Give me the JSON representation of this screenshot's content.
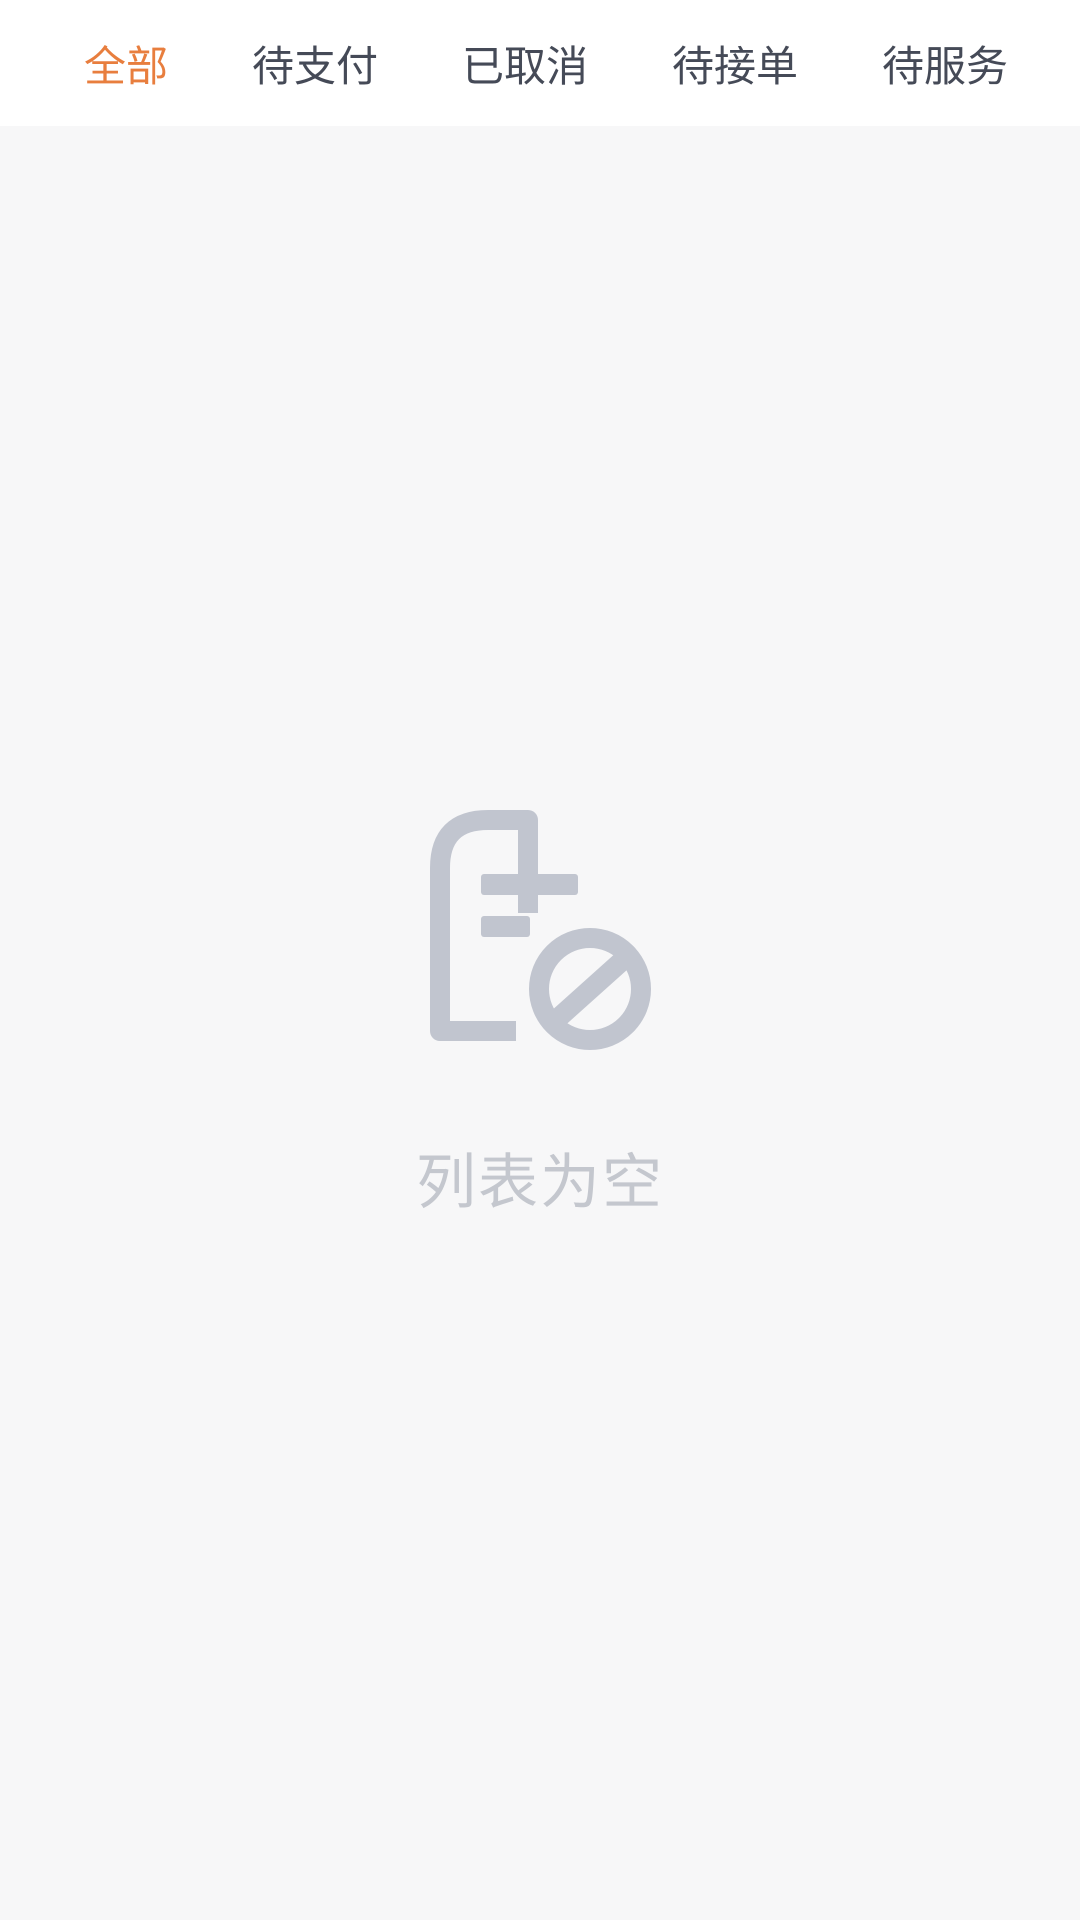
{
  "tabs": [
    {
      "label": "全部",
      "active": true
    },
    {
      "label": "待支付",
      "active": false
    },
    {
      "label": "已取消",
      "active": false
    },
    {
      "label": "待接单",
      "active": false
    },
    {
      "label": "待服务",
      "active": false
    }
  ],
  "empty_state": {
    "icon": "empty-list-icon",
    "text": "列表为空"
  },
  "colors": {
    "accent": "#e87e3e",
    "tab_text": "#454a57",
    "icon": "#c1c5cf",
    "empty_text": "#c4c7ce",
    "background": "#f7f7f8",
    "header_bg": "#ffffff"
  }
}
